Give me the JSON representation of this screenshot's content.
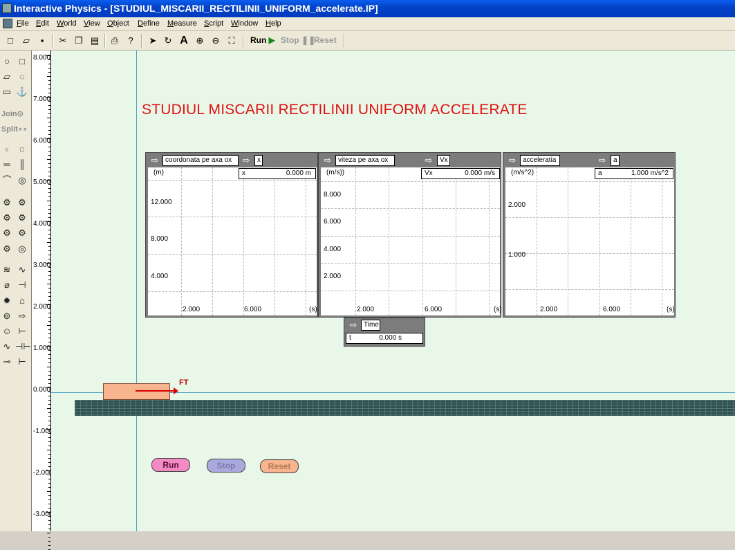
{
  "window": {
    "title": "Interactive Physics - [STUDIUL_MISCARII_RECTILINII_UNIFORM_accelerate.IP]"
  },
  "menu": [
    "File",
    "Edit",
    "World",
    "View",
    "Object",
    "Define",
    "Measure",
    "Script",
    "Window",
    "Help"
  ],
  "toolbar": {
    "run": "Run",
    "stop": "Stop",
    "reset": "Reset"
  },
  "palette": {
    "join": "Join",
    "split": "Split"
  },
  "ruler": {
    "labels": [
      "8.000",
      "7.000",
      "6.000",
      "5.000",
      "4.000",
      "3.000",
      "2.000",
      "1.000",
      "0.000",
      "-1.000",
      "-2.000",
      "-3.000"
    ]
  },
  "page": {
    "title": "STUDIUL MISCARII RECTILINII UNIFORM ACCELERATE"
  },
  "meters": [
    {
      "title": "coordonata pe axa ox",
      "unit": "(m)",
      "value_title": "x",
      "value_name": "x",
      "value": "0.000 m",
      "yticks": [
        "12.000",
        "8.000",
        "4.000"
      ],
      "xticks": [
        "2.000",
        "6.000",
        "(s)"
      ]
    },
    {
      "title": "viteza pe axa ox",
      "unit": "(m/s))",
      "value_title": "Vx",
      "value_name": "Vx",
      "value": "0.000 m/s",
      "yticks": [
        "8.000",
        "6.000",
        "4.000",
        "2.000"
      ],
      "xticks": [
        "2.000",
        "6.000",
        "(s)"
      ]
    },
    {
      "title": "acceleratia",
      "unit": "(m/s^2)",
      "value_title": "a",
      "value_name": "a",
      "value": "1.000 m/s^2",
      "yticks": [
        "2.000",
        "1.000"
      ],
      "xticks": [
        "2.000",
        "6.000",
        "(s)"
      ]
    }
  ],
  "time_meter": {
    "title": "Time",
    "name": "t",
    "value": "0.000 s"
  },
  "force": {
    "label": "FT"
  },
  "controls": {
    "run": "Run",
    "stop": "Stop",
    "reset": "Reset"
  },
  "colors": {
    "title_red": "#e01010",
    "run_pink": "#f28ac3",
    "stop_lavender": "#a9a9dd",
    "reset_peach": "#f7b48e",
    "block": "#f7b48e",
    "canvas": "#e9f7e9"
  }
}
